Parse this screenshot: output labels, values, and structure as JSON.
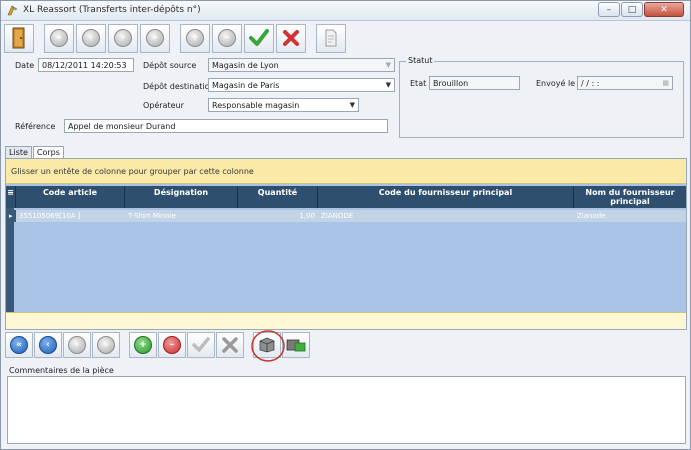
{
  "window": {
    "title": "XL Reassort (Transferts inter-dépôts n°)",
    "controls": {
      "minimize": "–",
      "maximize": "□",
      "close": "✕"
    }
  },
  "toolbar": {
    "icons": [
      "door-exit-icon",
      "first-record-icon",
      "previous-record-icon",
      "next-record-icon",
      "last-record-icon",
      "add-icon",
      "delete-icon",
      "validate-icon",
      "cancel-icon",
      "document-icon"
    ]
  },
  "form": {
    "date_label": "Date",
    "date_value": "08/12/2011 14:20:53",
    "depot_source_label": "Dépôt source",
    "depot_source_value": "Magasin de Lyon",
    "depot_destination_label": "Dépôt destination",
    "depot_destination_value": "Magasin de Paris",
    "operateur_label": "Opérateur",
    "operateur_value": "Responsable magasin",
    "reference_label": "Référence",
    "reference_value": "Appel de monsieur Durand"
  },
  "statut": {
    "title": "Statut",
    "etat_label": "Etat",
    "etat_value": "Brouillon",
    "envoye_label": "Envoyé le",
    "envoye_value": " / /      :  :"
  },
  "tabs": [
    {
      "label": "Liste",
      "active": false
    },
    {
      "label": "Corps",
      "active": true
    }
  ],
  "grid": {
    "group_hint": "Glisser un entête de colonne pour grouper par cette colonne",
    "columns": [
      "Code article",
      "Désignation",
      "Quantité",
      "Code du fournisseur principal",
      "Nom du fournisseur principal"
    ],
    "rows": [
      {
        "code": "355105069[10A   ]",
        "designation": "T-Shirt Minnie",
        "quantite": "1,00",
        "code_fournisseur": "ZIANODE",
        "nom_fournisseur": "Zianode"
      }
    ]
  },
  "comments": {
    "label": "Commentaires de la pièce",
    "value": ""
  },
  "colors": {
    "grid_header": "#2f4f6e",
    "grid_body": "#a9c4e6",
    "group_bar": "#fbe9a8",
    "highlight_ring": "#c0392b"
  }
}
